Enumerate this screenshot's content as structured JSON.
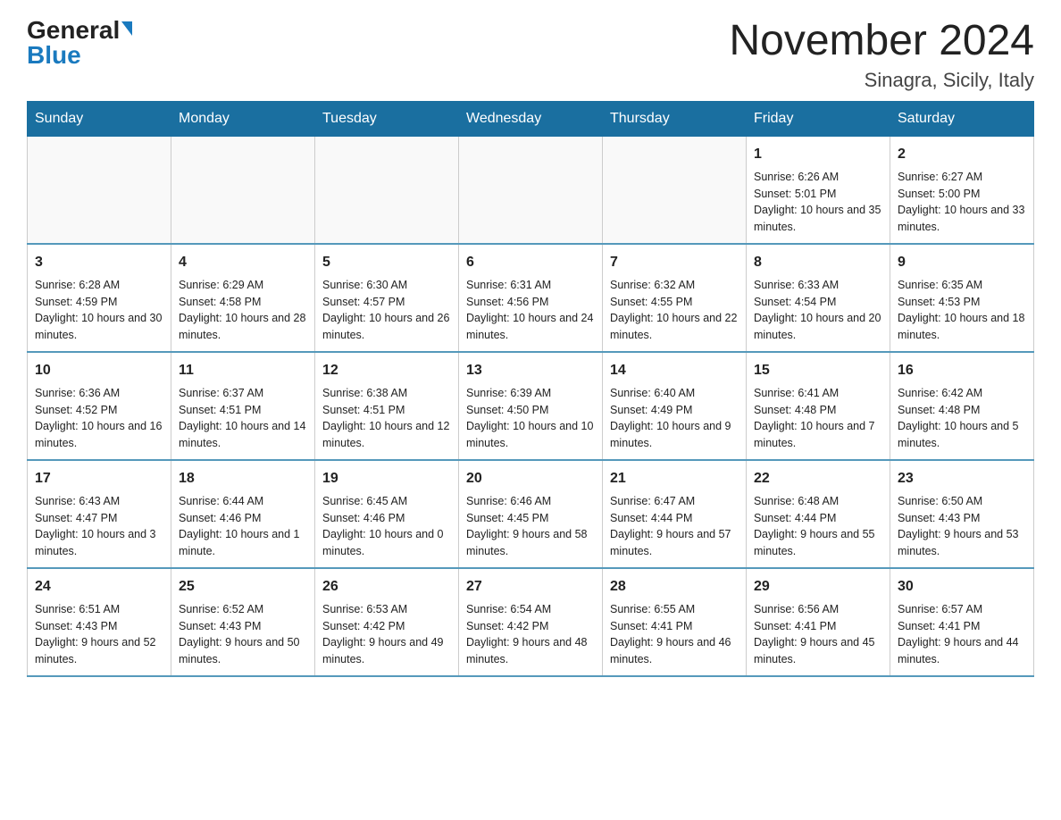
{
  "header": {
    "logo_general": "General",
    "logo_blue": "Blue",
    "title": "November 2024",
    "subtitle": "Sinagra, Sicily, Italy"
  },
  "weekdays": [
    "Sunday",
    "Monday",
    "Tuesday",
    "Wednesday",
    "Thursday",
    "Friday",
    "Saturday"
  ],
  "weeks": [
    [
      {
        "day": "",
        "info": ""
      },
      {
        "day": "",
        "info": ""
      },
      {
        "day": "",
        "info": ""
      },
      {
        "day": "",
        "info": ""
      },
      {
        "day": "",
        "info": ""
      },
      {
        "day": "1",
        "info": "Sunrise: 6:26 AM\nSunset: 5:01 PM\nDaylight: 10 hours and 35 minutes."
      },
      {
        "day": "2",
        "info": "Sunrise: 6:27 AM\nSunset: 5:00 PM\nDaylight: 10 hours and 33 minutes."
      }
    ],
    [
      {
        "day": "3",
        "info": "Sunrise: 6:28 AM\nSunset: 4:59 PM\nDaylight: 10 hours and 30 minutes."
      },
      {
        "day": "4",
        "info": "Sunrise: 6:29 AM\nSunset: 4:58 PM\nDaylight: 10 hours and 28 minutes."
      },
      {
        "day": "5",
        "info": "Sunrise: 6:30 AM\nSunset: 4:57 PM\nDaylight: 10 hours and 26 minutes."
      },
      {
        "day": "6",
        "info": "Sunrise: 6:31 AM\nSunset: 4:56 PM\nDaylight: 10 hours and 24 minutes."
      },
      {
        "day": "7",
        "info": "Sunrise: 6:32 AM\nSunset: 4:55 PM\nDaylight: 10 hours and 22 minutes."
      },
      {
        "day": "8",
        "info": "Sunrise: 6:33 AM\nSunset: 4:54 PM\nDaylight: 10 hours and 20 minutes."
      },
      {
        "day": "9",
        "info": "Sunrise: 6:35 AM\nSunset: 4:53 PM\nDaylight: 10 hours and 18 minutes."
      }
    ],
    [
      {
        "day": "10",
        "info": "Sunrise: 6:36 AM\nSunset: 4:52 PM\nDaylight: 10 hours and 16 minutes."
      },
      {
        "day": "11",
        "info": "Sunrise: 6:37 AM\nSunset: 4:51 PM\nDaylight: 10 hours and 14 minutes."
      },
      {
        "day": "12",
        "info": "Sunrise: 6:38 AM\nSunset: 4:51 PM\nDaylight: 10 hours and 12 minutes."
      },
      {
        "day": "13",
        "info": "Sunrise: 6:39 AM\nSunset: 4:50 PM\nDaylight: 10 hours and 10 minutes."
      },
      {
        "day": "14",
        "info": "Sunrise: 6:40 AM\nSunset: 4:49 PM\nDaylight: 10 hours and 9 minutes."
      },
      {
        "day": "15",
        "info": "Sunrise: 6:41 AM\nSunset: 4:48 PM\nDaylight: 10 hours and 7 minutes."
      },
      {
        "day": "16",
        "info": "Sunrise: 6:42 AM\nSunset: 4:48 PM\nDaylight: 10 hours and 5 minutes."
      }
    ],
    [
      {
        "day": "17",
        "info": "Sunrise: 6:43 AM\nSunset: 4:47 PM\nDaylight: 10 hours and 3 minutes."
      },
      {
        "day": "18",
        "info": "Sunrise: 6:44 AM\nSunset: 4:46 PM\nDaylight: 10 hours and 1 minute."
      },
      {
        "day": "19",
        "info": "Sunrise: 6:45 AM\nSunset: 4:46 PM\nDaylight: 10 hours and 0 minutes."
      },
      {
        "day": "20",
        "info": "Sunrise: 6:46 AM\nSunset: 4:45 PM\nDaylight: 9 hours and 58 minutes."
      },
      {
        "day": "21",
        "info": "Sunrise: 6:47 AM\nSunset: 4:44 PM\nDaylight: 9 hours and 57 minutes."
      },
      {
        "day": "22",
        "info": "Sunrise: 6:48 AM\nSunset: 4:44 PM\nDaylight: 9 hours and 55 minutes."
      },
      {
        "day": "23",
        "info": "Sunrise: 6:50 AM\nSunset: 4:43 PM\nDaylight: 9 hours and 53 minutes."
      }
    ],
    [
      {
        "day": "24",
        "info": "Sunrise: 6:51 AM\nSunset: 4:43 PM\nDaylight: 9 hours and 52 minutes."
      },
      {
        "day": "25",
        "info": "Sunrise: 6:52 AM\nSunset: 4:43 PM\nDaylight: 9 hours and 50 minutes."
      },
      {
        "day": "26",
        "info": "Sunrise: 6:53 AM\nSunset: 4:42 PM\nDaylight: 9 hours and 49 minutes."
      },
      {
        "day": "27",
        "info": "Sunrise: 6:54 AM\nSunset: 4:42 PM\nDaylight: 9 hours and 48 minutes."
      },
      {
        "day": "28",
        "info": "Sunrise: 6:55 AM\nSunset: 4:41 PM\nDaylight: 9 hours and 46 minutes."
      },
      {
        "day": "29",
        "info": "Sunrise: 6:56 AM\nSunset: 4:41 PM\nDaylight: 9 hours and 45 minutes."
      },
      {
        "day": "30",
        "info": "Sunrise: 6:57 AM\nSunset: 4:41 PM\nDaylight: 9 hours and 44 minutes."
      }
    ]
  ]
}
